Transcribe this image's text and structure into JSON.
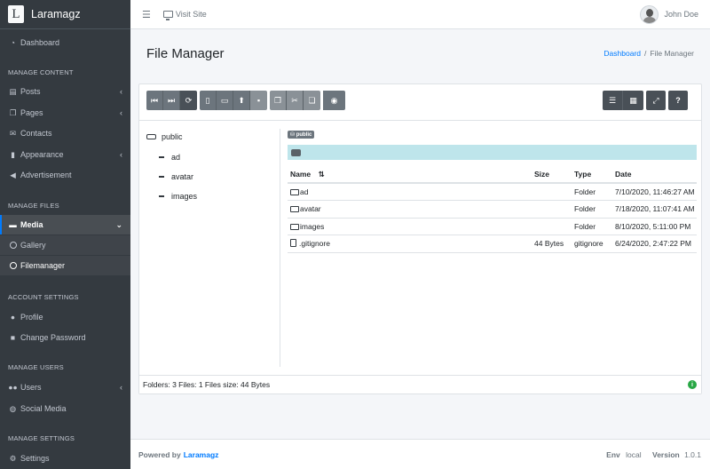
{
  "brand": {
    "logo": "L",
    "name": "Laramagz"
  },
  "sidebar": {
    "dashboard": "Dashboard",
    "h_content": "MANAGE CONTENT",
    "posts": "Posts",
    "pages": "Pages",
    "contacts": "Contacts",
    "appearance": "Appearance",
    "advertisement": "Advertisement",
    "h_files": "MANAGE FILES",
    "media": "Media",
    "gallery": "Gallery",
    "filemanager": "Filemanager",
    "h_account": "ACCOUNT SETTINGS",
    "profile": "Profile",
    "change_password": "Change Password",
    "h_users": "MANAGE USERS",
    "users": "Users",
    "social_media": "Social Media",
    "h_settings": "MANAGE SETTINGS",
    "settings": "Settings"
  },
  "topbar": {
    "visit": "Visit Site",
    "user": "John Doe"
  },
  "page": {
    "title": "File Manager",
    "crumb_home": "Dashboard",
    "crumb_current": "File Manager"
  },
  "tree": {
    "root": "public",
    "children": [
      "ad",
      "avatar",
      "images"
    ]
  },
  "content": {
    "badge": "public",
    "columns": {
      "name": "Name",
      "size": "Size",
      "type": "Type",
      "date": "Date"
    },
    "rows": [
      {
        "name": "ad",
        "size": "",
        "type": "Folder",
        "date": "7/10/2020, 11:46:27 AM",
        "kind": "folder"
      },
      {
        "name": "avatar",
        "size": "",
        "type": "Folder",
        "date": "7/18/2020, 11:07:41 AM",
        "kind": "folder"
      },
      {
        "name": "images",
        "size": "",
        "type": "Folder",
        "date": "8/10/2020, 5:11:00 PM",
        "kind": "folder"
      },
      {
        "name": ".gitignore",
        "size": "44 Bytes",
        "type": "gitignore",
        "date": "6/24/2020, 2:47:22 PM",
        "kind": "file"
      }
    ],
    "status": "Folders: 3 Files: 1 Files size: 44 Bytes"
  },
  "footer": {
    "powered": "Powered by",
    "brand": "Laramagz",
    "env_label": "Env",
    "env_value": "local",
    "version_label": "Version",
    "version_value": "1.0.1"
  },
  "colors": {
    "sidebar": "#343a40",
    "accent": "#007bff",
    "button": "#6c757d",
    "pathbar": "#bee5eb",
    "success": "#28a745"
  }
}
